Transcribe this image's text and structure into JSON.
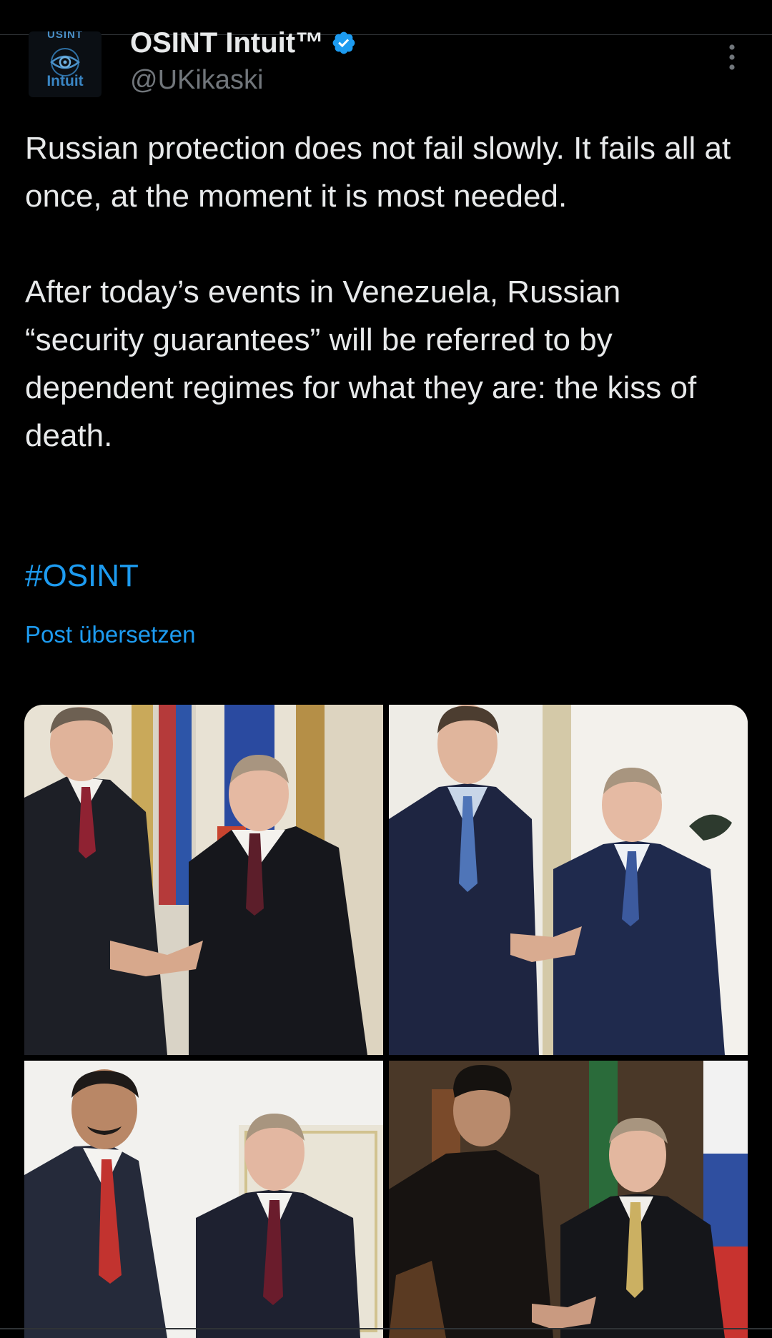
{
  "author": {
    "avatar_top_text": "USINT",
    "avatar_bottom_text": "Intuit",
    "display_name": "OSINT Intuit™",
    "handle": "@UKikaski"
  },
  "tweet": {
    "paragraph_1": "Russian protection does not fail slowly. It fails all at once, at the moment it is most needed.",
    "paragraph_2": "After today’s events in Venezuela, Russian “security guarantees” will be referred to by dependent regimes for what they are: the kiss of death.",
    "hashtag": "#OSINT",
    "translate_label": "Post übersetzen"
  },
  "colors": {
    "background": "#000000",
    "text": "#e7e9ea",
    "secondary": "#71767b",
    "accent": "#1d9bf0"
  },
  "icons": [
    "verified-badge-icon",
    "more-options-icon"
  ]
}
